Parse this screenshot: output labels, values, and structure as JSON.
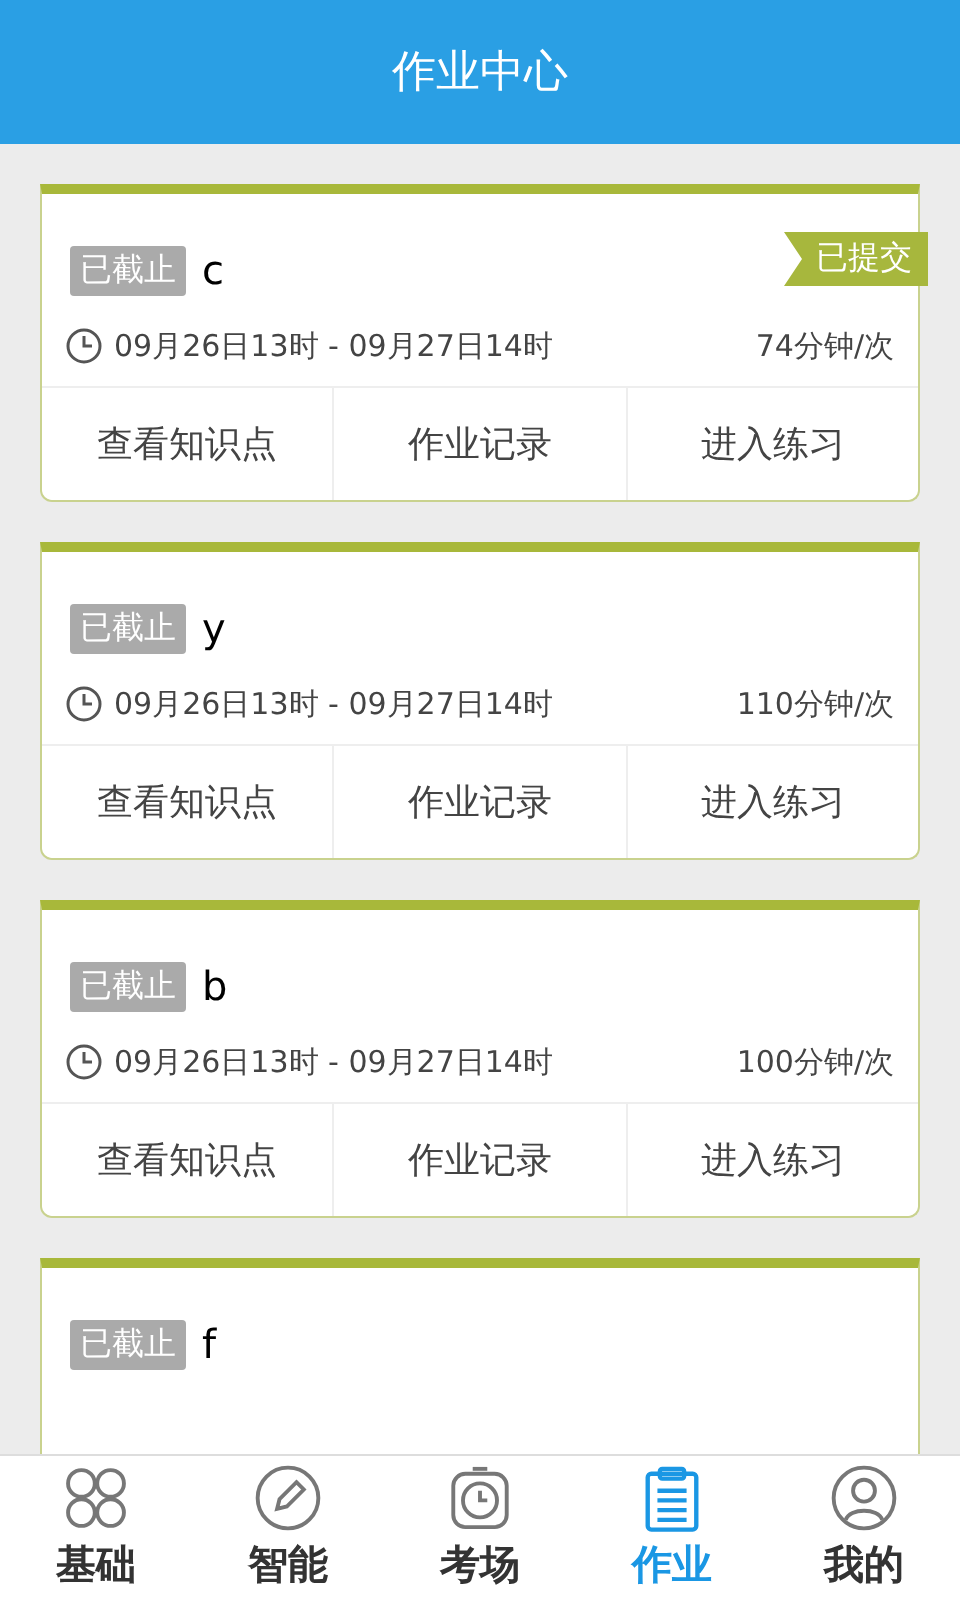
{
  "header": {
    "title": "作业中心"
  },
  "assignments": [
    {
      "status": "已截止",
      "name": "c",
      "submitted_badge": "已提交",
      "time": "09月26日13时 - 09月27日14时",
      "duration": "74分钟/次",
      "actions": [
        "查看知识点",
        "作业记录",
        "进入练习"
      ]
    },
    {
      "status": "已截止",
      "name": "y",
      "time": "09月26日13时 - 09月27日14时",
      "duration": "110分钟/次",
      "actions": [
        "查看知识点",
        "作业记录",
        "进入练习"
      ]
    },
    {
      "status": "已截止",
      "name": "b",
      "time": "09月26日13时 - 09月27日14时",
      "duration": "100分钟/次",
      "actions": [
        "查看知识点",
        "作业记录",
        "进入练习"
      ]
    },
    {
      "status": "已截止",
      "name": "f"
    }
  ],
  "tab_bar": [
    {
      "label": "基础",
      "kind": "clover",
      "selected": false
    },
    {
      "label": "智能",
      "kind": "pencil",
      "selected": false
    },
    {
      "label": "考场",
      "kind": "clock",
      "selected": false
    },
    {
      "label": "作业",
      "kind": "clipboard",
      "selected": true
    },
    {
      "label": "我的",
      "kind": "person",
      "selected": false
    }
  ]
}
